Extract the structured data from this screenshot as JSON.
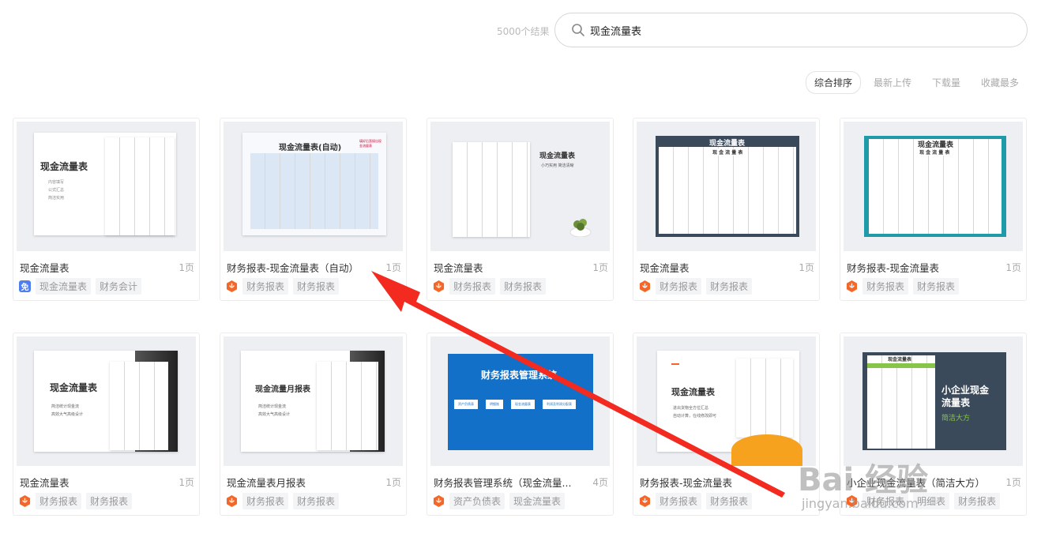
{
  "header": {
    "result_count": "5000个结果",
    "search_value": "现金流量表"
  },
  "sort": [
    "综合排序",
    "最新上传",
    "下载量",
    "收藏最多"
  ],
  "cards": [
    {
      "title": "现金流量表",
      "pages": "1页",
      "badge": "免",
      "badge_type": "free",
      "tags": [
        "现金流量表",
        "财务会计"
      ],
      "thumb": {
        "heading": "现金流量表",
        "menu": [
          "内容填写",
          "公式汇总",
          "简洁实用"
        ]
      }
    },
    {
      "title": "财务报表-现金流量表（自动）",
      "pages": "1页",
      "badge_type": "logo",
      "tags": [
        "财务报表",
        "财务报表"
      ],
      "thumb": {
        "heading": "现金流量表(自动)",
        "side": "填好后直接出现金流量表"
      }
    },
    {
      "title": "现金流量表",
      "pages": "1页",
      "badge_type": "logo",
      "tags": [
        "财务报表",
        "财务报表"
      ],
      "thumb": {
        "heading": "现金流量表",
        "note": "小巧实用 简洁清晰"
      }
    },
    {
      "title": "现金流量表",
      "pages": "1页",
      "badge_type": "logo",
      "tags": [
        "财务报表",
        "财务报表"
      ],
      "thumb": {
        "heading": "现金流量表",
        "sub": "现 金 流 量 表"
      }
    },
    {
      "title": "财务报表-现金流量表",
      "pages": "1页",
      "badge_type": "logo",
      "tags": [
        "财务报表",
        "财务报表"
      ],
      "thumb": {
        "heading": "现金流量表",
        "sub": "现 金 流 量 表"
      }
    },
    {
      "title": "现金流量表",
      "pages": "1页",
      "badge_type": "logo",
      "tags": [
        "财务报表",
        "财务报表"
      ],
      "thumb": {
        "heading": "现金流量表",
        "menu": [
          "简洁统计现金流",
          "高效大气高级设计"
        ]
      }
    },
    {
      "title": "现金流量表月报表",
      "pages": "1页",
      "badge_type": "logo",
      "tags": [
        "财务报表",
        "财务报表"
      ],
      "thumb": {
        "heading": "现金流量月报表",
        "menu": [
          "简洁统计现金流",
          "高效大气高级设计"
        ]
      }
    },
    {
      "title": "财务报表管理系统（现金流量...",
      "pages": "4页",
      "badge_type": "logo",
      "tags": [
        "资产负债表",
        "现金流量表"
      ],
      "thumb": {
        "heading": "财务报表管理系统",
        "buttons": [
          "资产负债表",
          "明细账",
          "现金流量表",
          "利润及利润分配表"
        ]
      }
    },
    {
      "title": "财务报表-现金流量表",
      "pages": "",
      "badge_type": "logo",
      "tags": [
        "财务报表",
        "财务报表"
      ],
      "thumb": {
        "heading": "现金流量表",
        "menu": [
          "进出货物全方位汇总",
          "自动计算，在线修改即可"
        ]
      }
    },
    {
      "title": "小企业现金流量表（简洁大方）",
      "pages": "1页",
      "badge_type": "logo",
      "tags": [
        "财务报表",
        "明细表",
        "财务报表"
      ],
      "thumb": {
        "heading": "小企业现金流量表",
        "sub": "简洁大方",
        "sheet_title": "现金流量表"
      }
    }
  ],
  "watermark": {
    "brand": "Bai 经验",
    "url": "jingyan.baidu.com"
  },
  "colors": {
    "accent_orange": "#f4672a",
    "free_badge": "#4f7ef0",
    "arrow": "#f22a1f",
    "system_blue": "#1270c8",
    "slate": "#3b4a5b",
    "teal": "#1f9aa8"
  }
}
